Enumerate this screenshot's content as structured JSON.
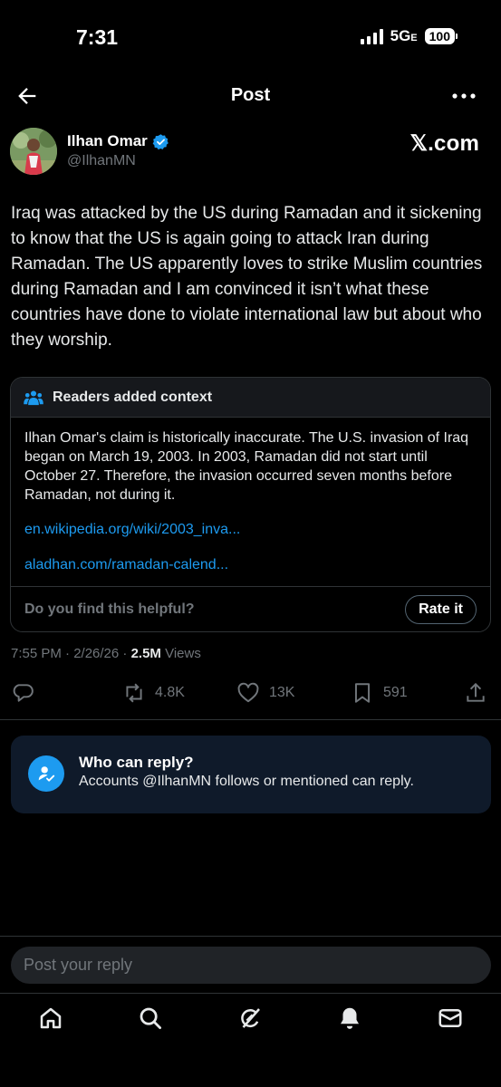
{
  "status_bar": {
    "time": "7:31",
    "network": "5G",
    "network_suffix": "E",
    "battery": "100"
  },
  "header": {
    "title": "Post",
    "back_icon": "arrow-left-icon",
    "more_icon": "more-horizontal-icon"
  },
  "author": {
    "name": "Ilhan Omar",
    "handle": "@IlhanMN",
    "verified": true,
    "source": "𝕏.com"
  },
  "post": {
    "text": "Iraq was attacked by the US during Ramadan and it sickening to know that the US is again going to attack Iran during Ramadan.  The US apparently loves to strike Muslim countries during Ramadan and I am convinced it isn’t what these countries have done to violate international law but about who they worship.",
    "time": "7:55 PM · 2/26/26 · ",
    "views_count": "2.5M",
    "views_label": " Views"
  },
  "community_note": {
    "title": "Readers added context",
    "body": "Ilhan Omar's claim is historically inaccurate. The U.S. invasion of Iraq began on March 19, 2003. In 2003, Ramadan did not start until October 27. Therefore, the invasion occurred seven months before Ramadan, not during it.",
    "links": [
      "en.wikipedia.org/wiki/2003_inva...",
      "aladhan.com/ramadan-calend..."
    ],
    "helpful_question": "Do you find this helpful?",
    "rate_label": "Rate it"
  },
  "actions": {
    "reply_icon": "reply-icon",
    "repost_count": "4.8K",
    "like_count": "13K",
    "bookmark_count": "591",
    "share_icon": "share-icon"
  },
  "reply_restriction": {
    "title": "Who can reply?",
    "subtitle": "Accounts @IlhanMN follows or mentioned can reply."
  },
  "reply_box": {
    "placeholder": "Post your reply"
  },
  "bottom_nav": [
    "home-icon",
    "search-icon",
    "grok-icon",
    "notifications-icon",
    "messages-icon"
  ],
  "colors": {
    "background": "#000000",
    "accent": "#1d9bf0",
    "muted": "#71767b",
    "reply_card": "#0f1a2a"
  }
}
